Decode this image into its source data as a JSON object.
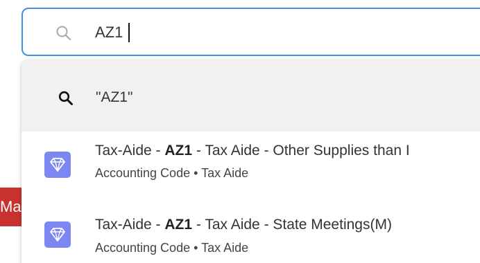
{
  "background": {
    "tab_text": "Ma"
  },
  "search": {
    "value": "AZ1",
    "icon": "search-icon"
  },
  "dropdown": {
    "query_suggestion": "\"AZ1\"",
    "results": [
      {
        "title_prefix": "Tax-Aide - ",
        "title_match": "AZ1",
        "title_suffix": " - Tax Aide - Other Supplies than I",
        "type": "Accounting Code",
        "separator": "•",
        "category": "Tax Aide",
        "icon": "diamond-icon"
      },
      {
        "title_prefix": "Tax-Aide - ",
        "title_match": "AZ1",
        "title_suffix": " - Tax Aide - State Meetings(M)",
        "type": "Accounting Code",
        "separator": "•",
        "category": "Tax Aide",
        "icon": "diamond-icon"
      }
    ]
  },
  "colors": {
    "focus_border": "#3f8fe3",
    "icon_badge": "#7d87f1",
    "bg_tab": "#c8312e",
    "query_row_bg": "#f1f1f1"
  }
}
